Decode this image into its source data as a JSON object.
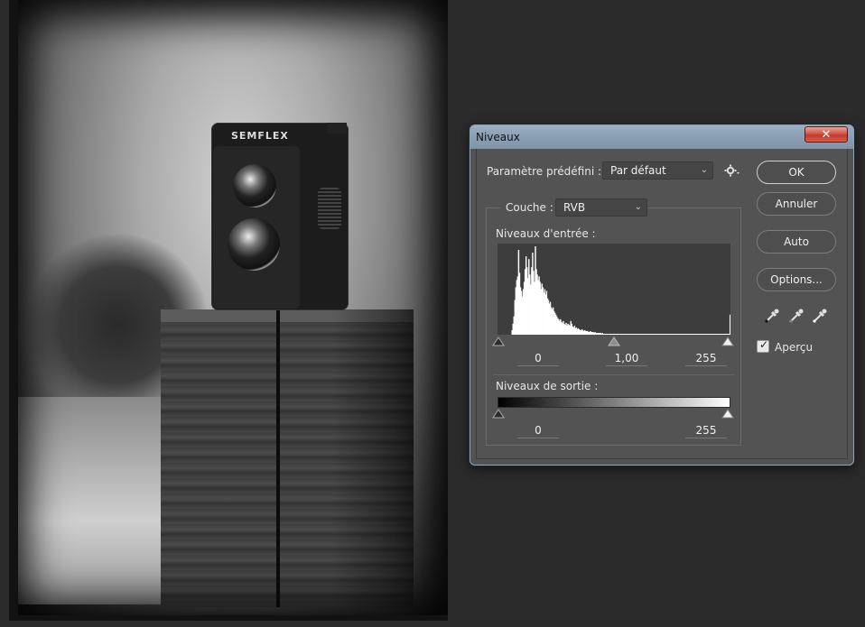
{
  "dialog": {
    "title": "Niveaux",
    "close_symbol": "✕",
    "preset": {
      "label": "Paramètre prédéfini :",
      "value": "Par défaut"
    },
    "channel": {
      "label": "Couche :",
      "value": "RVB"
    },
    "input_levels": {
      "label": "Niveaux d'entrée :",
      "black": "0",
      "gamma": "1,00",
      "white": "255"
    },
    "output_levels": {
      "label": "Niveaux de sortie :",
      "black": "0",
      "white": "255"
    },
    "buttons": {
      "ok": "OK",
      "cancel": "Annuler",
      "auto": "Auto",
      "options": "Options..."
    },
    "preview": {
      "label": "Aperçu",
      "checked": true
    },
    "eyedroppers": [
      "black-point-eyedropper-icon",
      "gray-point-eyedropper-icon",
      "white-point-eyedropper-icon"
    ]
  },
  "photo": {
    "camera_brand": "SEMFLEX"
  },
  "histogram": {
    "channel": "RVB",
    "bins_0_to_255_relative": [
      0,
      0,
      0,
      0,
      0,
      0,
      0,
      0,
      0,
      0,
      0,
      0,
      0,
      0,
      0,
      0.05,
      0.12,
      0.2,
      0.38,
      0.52,
      0.6,
      0.64,
      0.93,
      0.68,
      0.52,
      0.48,
      0.42,
      0.5,
      0.58,
      0.72,
      0.86,
      0.74,
      0.62,
      0.83,
      0.66,
      0.55,
      0.74,
      0.9,
      0.7,
      0.58,
      0.97,
      0.72,
      0.66,
      0.6,
      0.64,
      0.58,
      0.5,
      0.56,
      0.52,
      0.46,
      0.5,
      0.44,
      0.48,
      0.4,
      0.38,
      0.34,
      0.36,
      0.3,
      0.28,
      0.3,
      0.26,
      0.24,
      0.22,
      0.2,
      0.18,
      0.17,
      0.15,
      0.17,
      0.14,
      0.13,
      0.15,
      0.12,
      0.11,
      0.13,
      0.1,
      0.12,
      0.11,
      0.1,
      0.15,
      0.12,
      0.09,
      0.08,
      0.1,
      0.07,
      0.08,
      0.06,
      0.07,
      0.06,
      0.05,
      0.05,
      0.06,
      0.05,
      0.04,
      0.05,
      0.04,
      0.04,
      0.04,
      0.03,
      0.03,
      0.04,
      0.03,
      0.03,
      0.03,
      0.02,
      0.03,
      0.02,
      0.02,
      0.02,
      0.02,
      0.02,
      0.02,
      0.01,
      0.02,
      0.01,
      0.01,
      0.01,
      0.01,
      0.01,
      0.01,
      0.01,
      0.01,
      0.01,
      0.01,
      0.01,
      0.01,
      0.01,
      0.01,
      0.01,
      0.01,
      0.01,
      0.01,
      0.01,
      0.01,
      0.01,
      0.01,
      0.01,
      0.01,
      0.01,
      0.01,
      0.01,
      0.01,
      0.01,
      0.01,
      0.01,
      0.01,
      0.01,
      0.01,
      0.01,
      0.01,
      0.01,
      0.01,
      0.01,
      0.01,
      0.01,
      0.01,
      0.01,
      0.01,
      0.01,
      0.01,
      0.01,
      0.01,
      0.01,
      0.01,
      0.01,
      0.01,
      0.01,
      0.01,
      0.01,
      0.01,
      0.01,
      0.01,
      0.01,
      0.01,
      0.01,
      0.01,
      0.01,
      0.01,
      0.01,
      0.01,
      0.01,
      0.01,
      0.01,
      0.01,
      0.01,
      0.01,
      0.01,
      0.01,
      0.01,
      0.01,
      0.01,
      0.01,
      0.01,
      0.01,
      0.01,
      0.01,
      0.01,
      0.01,
      0.01,
      0.01,
      0.01,
      0.01,
      0.01,
      0.01,
      0.01,
      0.01,
      0.01,
      0.01,
      0.01,
      0.01,
      0.01,
      0.01,
      0.01,
      0.01,
      0.01,
      0.01,
      0.01,
      0.01,
      0.01,
      0.01,
      0.01,
      0.01,
      0.01,
      0.01,
      0.01,
      0.01,
      0.01,
      0.01,
      0.01,
      0.01,
      0.01,
      0.01,
      0.01,
      0.01,
      0.01,
      0.01,
      0.01,
      0.01,
      0.01,
      0.01,
      0.01,
      0.01,
      0.01,
      0.01,
      0.01,
      0.01,
      0.01,
      0.01,
      0.01,
      0.01,
      0.22
    ]
  }
}
